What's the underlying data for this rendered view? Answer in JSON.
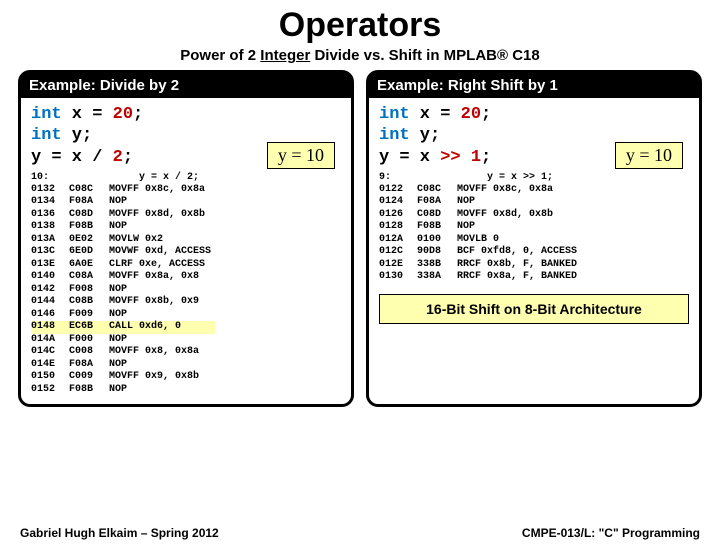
{
  "title": "Operators",
  "subtitle_pre": "Power of 2 ",
  "subtitle_u": "Integer",
  "subtitle_post": " Divide vs. Shift in MPLAB® C18",
  "left": {
    "header": "Example: Divide by 2",
    "code_l1_kw": "int",
    "code_l1_rest": " x = ",
    "code_l1_num": "20",
    "code_l2_kw": "int",
    "code_l2_rest": " y;",
    "code_l3_pre": "y = x / ",
    "code_l3_num": "2",
    "ybox": "y = 10",
    "src_label": "10:",
    "src_expr": "y = x / 2;",
    "asm": [
      [
        "0132",
        "C08C",
        "MOVFF 0x8c, 0x8a"
      ],
      [
        "0134",
        "F08A",
        "NOP"
      ],
      [
        "0136",
        "C08D",
        "MOVFF 0x8d, 0x8b"
      ],
      [
        "0138",
        "F08B",
        "NOP"
      ],
      [
        "013A",
        "0E02",
        "MOVLW 0x2"
      ],
      [
        "013C",
        "6E0D",
        "MOVWF 0xd, ACCESS"
      ],
      [
        "013E",
        "6A0E",
        "CLRF 0xe, ACCESS"
      ],
      [
        "0140",
        "C08A",
        "MOVFF 0x8a, 0x8"
      ],
      [
        "0142",
        "F008",
        "NOP"
      ],
      [
        "0144",
        "C08B",
        "MOVFF 0x8b, 0x9"
      ],
      [
        "0146",
        "F009",
        "NOP"
      ],
      [
        "0148",
        "EC6B",
        "CALL 0xd6, 0"
      ],
      [
        "014A",
        "F000",
        "NOP"
      ],
      [
        "014C",
        "C008",
        "MOVFF 0x8, 0x8a"
      ],
      [
        "014E",
        "F08A",
        "NOP"
      ],
      [
        "0150",
        "C009",
        "MOVFF 0x9, 0x8b"
      ],
      [
        "0152",
        "F08B",
        "NOP"
      ]
    ]
  },
  "right": {
    "header": "Example: Right Shift by 1",
    "code_l1_kw": "int",
    "code_l1_rest": " x = ",
    "code_l1_num": "20",
    "code_l2_kw": "int",
    "code_l2_rest": " y;",
    "code_l3_pre": "y = x ",
    "code_l3_op": ">>",
    "code_l3_post": " ",
    "code_l3_num": "1",
    "ybox": "y = 10",
    "src_label": "9:",
    "src_expr": "y = x >> 1;",
    "asm": [
      [
        "0122",
        "C08C",
        "MOVFF 0x8c, 0x8a"
      ],
      [
        "0124",
        "F08A",
        "NOP"
      ],
      [
        "0126",
        "C08D",
        "MOVFF 0x8d, 0x8b"
      ],
      [
        "0128",
        "F08B",
        "NOP"
      ],
      [
        "012A",
        "0100",
        "MOVLB 0"
      ],
      [
        "012C",
        "90D8",
        "BCF 0xfd8, 0, ACCESS"
      ],
      [
        "012E",
        "338B",
        "RRCF 0x8b, F, BANKED"
      ],
      [
        "0130",
        "338A",
        "RRCF 0x8a, F, BANKED"
      ]
    ],
    "archbox": "16-Bit Shift on 8-Bit Architecture"
  },
  "footer_left": "Gabriel Hugh Elkaim – Spring 2012",
  "footer_right": "CMPE-013/L: \"C\" Programming"
}
